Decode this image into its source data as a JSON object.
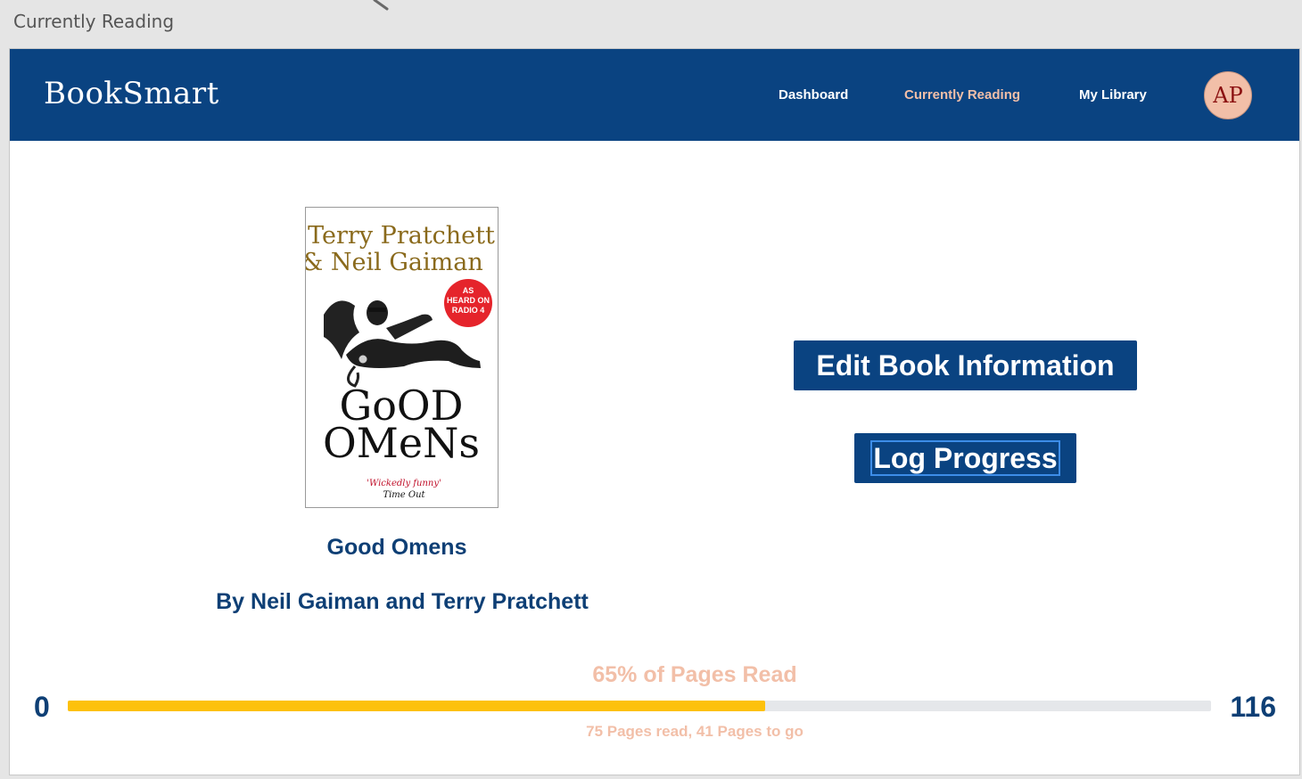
{
  "window": {
    "title": "Currently Reading"
  },
  "brand": {
    "name": "BookSmart"
  },
  "nav": {
    "items": [
      {
        "label": "Dashboard",
        "active": false
      },
      {
        "label": "Currently Reading",
        "active": true
      },
      {
        "label": "My Library",
        "active": false
      }
    ],
    "avatar_initials": "AP"
  },
  "book": {
    "title": "Good Omens",
    "byline": "By Neil Gaiman and Terry Pratchett",
    "cover": {
      "author_line_1": "Terry Pratchett",
      "author_line_2": "& Neil Gaiman",
      "badge": "AS HEARD ON RADIO 4",
      "title_line_1": "GoOD",
      "title_line_2": "OMeNs",
      "quote": "'Wickedly funny'",
      "quote_source": "Time Out"
    }
  },
  "actions": {
    "edit_label": "Edit Book Information",
    "log_label": "Log Progress"
  },
  "progress": {
    "percent_label": "65% of Pages Read",
    "min": "0",
    "max": "116",
    "pages_read": 75,
    "pages_total": 116,
    "fill_fraction": 0.61,
    "summary": "75 Pages read, 41 Pages to go"
  },
  "colors": {
    "nav_bg": "#0a4381",
    "accent_peach": "#f2bfa8",
    "progress_fill": "#fdc10c",
    "progress_track": "#e5e7ea",
    "heading_blue": "#0e3f75"
  }
}
